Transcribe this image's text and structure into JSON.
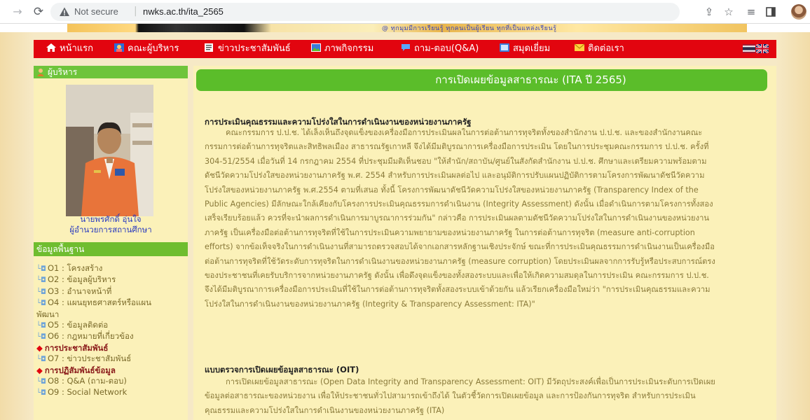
{
  "browser": {
    "security_label": "Not secure",
    "url": "nwks.ac.th/ita_2565"
  },
  "header": {
    "tagline": "@ ทุกมุมมีการเรียนรู้ ทุกคนเป็นผู้เรียน ทุกที่เป็นแหล่งเรียนรู้"
  },
  "menu": {
    "items": [
      {
        "label": "หน้าแรก",
        "icon": "home-icon"
      },
      {
        "label": "คณะผู้บริหาร",
        "icon": "people-icon"
      },
      {
        "label": "ข่าวประชาสัมพันธ์",
        "icon": "newspaper-icon"
      },
      {
        "label": "ภาพกิจกรรม",
        "icon": "gallery-icon"
      },
      {
        "label": "ถาม-ตอบ(Q&A)",
        "icon": "chat-icon"
      },
      {
        "label": "สมุดเยี่ยม",
        "icon": "guestbook-icon"
      },
      {
        "label": "ติดต่อเรา",
        "icon": "mail-icon"
      }
    ]
  },
  "sidebar": {
    "admin_header": "ผู้บริหาร",
    "director_name": "นายพรศักดิ์ อุ่นใจ",
    "director_title": "ผู้อำนวยการสถานศึกษา",
    "info_header": "ข้อมูลพื้นฐาน",
    "links": [
      {
        "type": "link",
        "label": "O1 : โครงสร้าง"
      },
      {
        "type": "link",
        "label": "O2 : ข้อมูลผู้บริหาร"
      },
      {
        "type": "link",
        "label": "O3 : อำนาจหน้าที่"
      },
      {
        "type": "link",
        "label": "O4 : แผนยุทธศาสตร์หรือแผน"
      },
      {
        "type": "cont",
        "label": "พัฒนา"
      },
      {
        "type": "link",
        "label": "O5 : ข้อมูลติดต่อ"
      },
      {
        "type": "link",
        "label": "O6 : กฎหมายที่เกี่ยวข้อง"
      },
      {
        "type": "cat",
        "label": "การประชาสัมพันธ์"
      },
      {
        "type": "link",
        "label": "O7 : ข่าวประชาสัมพันธ์"
      },
      {
        "type": "cat",
        "label": "การปฏิสัมพันธ์ข้อมูล"
      },
      {
        "type": "link",
        "label": "O8 : Q&A (ถาม-ตอบ)"
      },
      {
        "type": "link",
        "label": "O9 : Social Network"
      }
    ]
  },
  "main": {
    "title": "การเปิดเผยข้อมูลสาธารณะ (ITA ปี 2565)",
    "section1_heading": "การประเมินคุณธรรมและความโปร่งใสในการดำเนินงานของหน่วยงานภาครัฐ",
    "section1_lines": [
      "คณะกรรมการ ป.ป.ช. ได้เล็งเห็นถึงจุดแข็งของเครื่องมือการประเมินผลในการต่อต้านการทุจริตทั้งของสำนักงาน ป.ป.ช. และของสำนักงานคณะ",
      "กรรมการต่อต้านการทุจริตและสิทธิพลเมือง สาธารณรัฐเกาหลี จึงได้มีมติบูรณาการเครื่องมือการประเมิน โดยในการประชุมคณะกรรมการ ป.ป.ช. ครั้งที่",
      "304-51/2554 เมื่อวันที่ 14 กรกฎาคม 2554 ที่ประชุมมีมติเห็นชอบ \"ให้สำนัก/สถาบัน/ศูนย์ในสังกัดสำนักงาน ป.ป.ช. ศึกษาและเตรียมความพร้อมตาม",
      "ดัชนีวัดความโปร่งใสของหน่วยงานภาครัฐ พ.ศ. 2554 สำหรับการประเมินผลต่อไป และอนุมัติการปรับแผนปฏิบัติการตามโครงการพัฒนาดัชนีวัดความ",
      "โปร่งใสของหน่วยงานภาครัฐ พ.ศ.2554 ตามที่เสนอ ทั้งนี้ โครงการพัฒนาดัชนีวัดความโปร่งใสของหน่วยงานภาครัฐ (Transparency Index of the",
      "Public Agencies) มีลักษณะใกล้เคียงกับโครงการประเมินคุณธรรมการดำเนินงาน (Integrity Assessment) ดังนั้น เมื่อดำเนินการตามโครงการทั้งสอง",
      "เสร็จเรียบร้อยแล้ว ควรที่จะนำผลการดำเนินการมาบูรณาการร่วมกัน\" กล่าวคือ การประเมินผลตามดัชนีวัดความโปร่งใสในการดำเนินงานของหน่วยงาน",
      "ภาครัฐ เป็นเครื่องมือต่อต้านการทุจริตที่ใช้ในการประเมินความพยายามของหน่วยงานภาครัฐ ในการต่อต้านการทุจริต (measure anti-corruption",
      "efforts) จากข้อเท็จจริงในการดำเนินงานที่สามารถตรวจสอบได้จากเอกสารหลักฐานเชิงประจักษ์ ขณะที่การประเมินคุณธรรมการดำเนินงานเป็นเครื่องมือ",
      "ต่อต้านการทุจริตที่ใช้วัดระดับการทุจริตในการดำเนินงานของหน่วยงานภาครัฐ (measure corruption) โดยประเมินผลจากการรับรู้หรือประสบการณ์ตรง",
      "ของประชาชนที่เคยรับบริการจากหน่วยงานภาครัฐ ดังนั้น เพื่อดึงจุดแข็งของทั้งสองระบบและเพื่อให้เกิดความสมดุลในการประเมิน คณะกรรมการ ป.ป.ช.",
      "จึงได้มีมติบูรณาการเครื่องมือการประเมินที่ใช้ในการต่อต้านการทุจริตทั้งสองระบบเข้าด้วยกัน แล้วเรียกเครื่องมือใหม่ว่า \"การประเมินคุณธรรมและความ",
      "โปร่งใสในการดำเนินงานของหน่วยงานภาครัฐ (Integrity & Transparency Assessment: ITA)\""
    ],
    "section2_heading": "แบบตรวจการเปิดเผยข้อมูลสาธารณะ (OIT)",
    "section2_lines": [
      "การเปิดเผยข้อมูลสาธารณะ (Open Data Integrity and Transparency Assessment: OIT) มีวัตถุประสงค์เพื่อเป็นการประเมินระดับการเปิดเผย",
      "ข้อมูลต่อสาธารณะของหน่วยงาน เพื่อให้ประชาชนทั่วไปสามารถเข้าถึงได้ ในตัวชี้วัดการเปิดเผยข้อมูล และการป้องกันการทุจริต สำหรับการประเมิน",
      "คุณธรรมและความโปร่งใสในการดำเนินงานของหน่วยงานภาครัฐ (ITA)"
    ]
  }
}
